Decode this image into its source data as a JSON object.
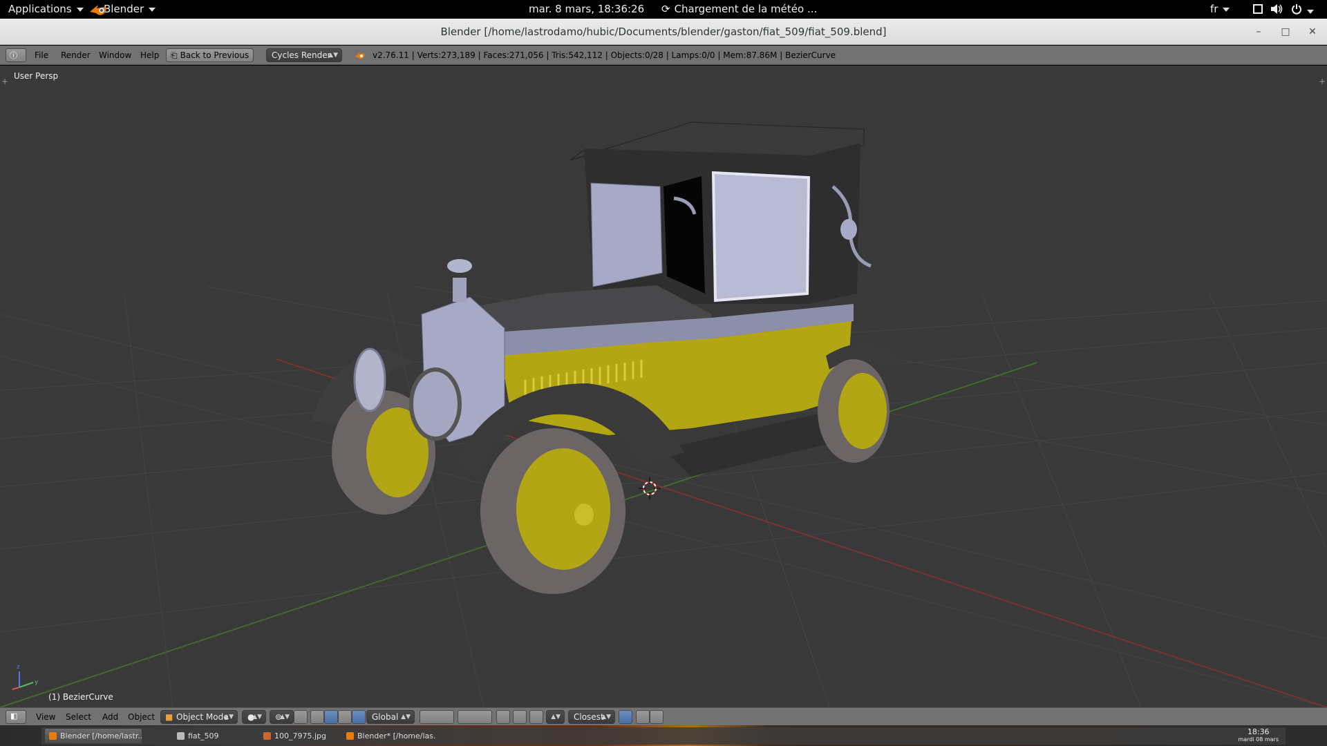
{
  "topbar": {
    "applications_label": "Applications",
    "app_menu_label": "Blender",
    "datetime": "mar.  8 mars, 18:36:26",
    "weather": "Chargement de la météo ...",
    "lang": "fr"
  },
  "window": {
    "title": "Blender [/home/lastrodamo/hubic/Documents/blender/gaston/fiat_509/fiat_509.blend]",
    "min": "–",
    "max": "□",
    "close": "✕"
  },
  "info_header": {
    "menus": [
      "File",
      "Render",
      "Window",
      "Help"
    ],
    "back_button": "Back to Previous",
    "render_engine": "Cycles Render",
    "stats": "v2.76.11 | Verts:273,189 | Faces:271,056 | Tris:542,112 | Objects:0/28 | Lamps:0/0 | Mem:87.86M | BezierCurve"
  },
  "viewport": {
    "view_label": "User Persp",
    "object_label": "(1) BezierCurve"
  },
  "view_header": {
    "menus": [
      "View",
      "Select",
      "Add",
      "Object"
    ],
    "mode": "Object Mode",
    "orientation": "Global",
    "snap_target": "Closest"
  },
  "taskbar": {
    "tasks": [
      {
        "label": "Blender [/home/lastr...",
        "icon": "blender-icon",
        "color": "#e87d0d"
      },
      {
        "label": "fiat_509",
        "icon": "folder-icon",
        "color": "#bbbbbb"
      },
      {
        "label": "100_7975.jpg",
        "icon": "image-icon",
        "color": "#cc6633"
      },
      {
        "label": "Blender* [/home/las...",
        "icon": "blender-icon",
        "color": "#e87d0d"
      }
    ],
    "clock_time": "18:36",
    "clock_date": "mardi 08 mars"
  },
  "colors": {
    "viewport_bg": "#393939",
    "header_bg": "#727272",
    "car_yellow": "#b3a614",
    "blender_orange": "#e87d0d"
  }
}
